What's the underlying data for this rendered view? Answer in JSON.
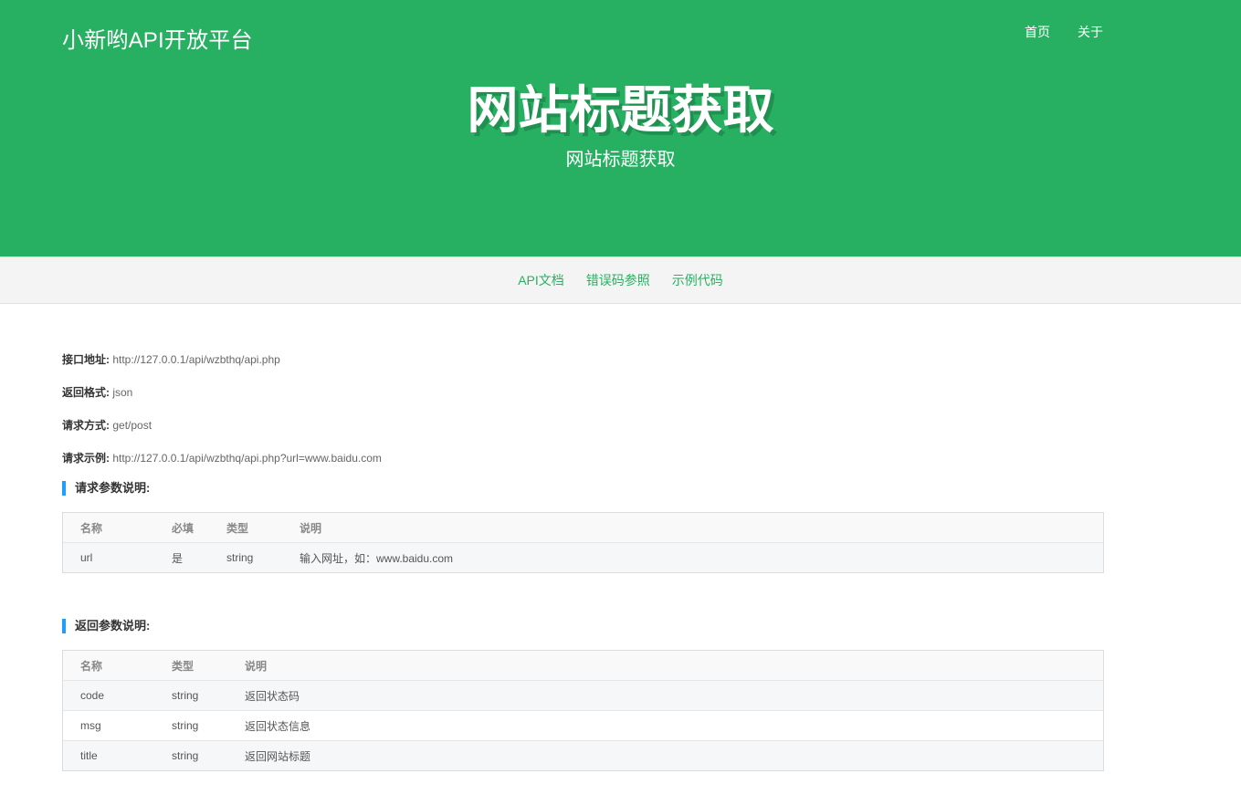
{
  "header": {
    "brand": "小新哟API开放平台",
    "nav": [
      {
        "label": "首页"
      },
      {
        "label": "关于"
      }
    ],
    "title": "网站标题获取",
    "subtitle": "网站标题获取"
  },
  "subnav": {
    "items": [
      {
        "label": "API文档"
      },
      {
        "label": "错误码参照"
      },
      {
        "label": "示例代码"
      }
    ]
  },
  "info": {
    "endpoint_label": "接口地址:",
    "endpoint": "http://127.0.0.1/api/wzbthq/api.php",
    "format_label": "返回格式:",
    "format": "json",
    "method_label": "请求方式:",
    "method": "get/post",
    "example_label": "请求示例:",
    "example": "http://127.0.0.1/api/wzbthq/api.php?url=www.baidu.com"
  },
  "request_params": {
    "heading": "请求参数说明:",
    "columns": [
      "名称",
      "必填",
      "类型",
      "说明"
    ],
    "rows": [
      [
        "url",
        "是",
        "string",
        "输入网址，如：www.baidu.com"
      ]
    ]
  },
  "response_params": {
    "heading": "返回参数说明:",
    "columns": [
      "名称",
      "类型",
      "说明"
    ],
    "rows": [
      [
        "code",
        "string",
        "返回状态码"
      ],
      [
        "msg",
        "string",
        "返回状态信息"
      ],
      [
        "title",
        "string",
        "返回网站标题"
      ]
    ]
  }
}
